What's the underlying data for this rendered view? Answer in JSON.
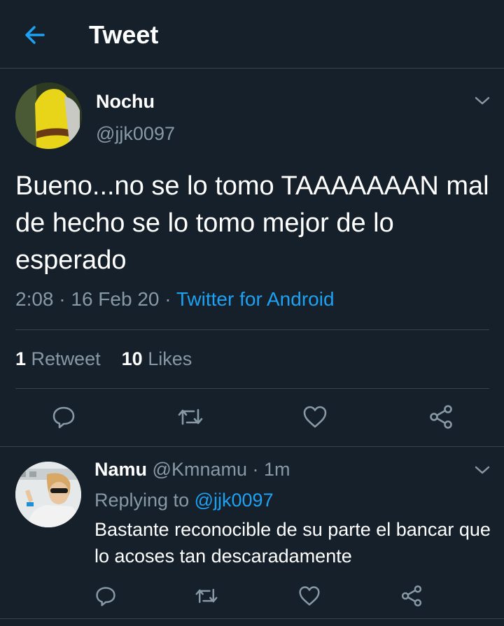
{
  "header": {
    "title": "Tweet",
    "back_icon": "arrow-left-icon"
  },
  "tweet": {
    "author_name": "Nochu",
    "author_handle": "@jjk0097",
    "text": "Bueno...no se lo tomo TAAAAAAAN mal de hecho se lo tomo mejor de lo esperado",
    "timestamp": "2:08 · 16 Feb 20 · ",
    "source": "Twitter for Android",
    "retweet_count": "1",
    "retweet_label": "Retweet",
    "like_count": "10",
    "like_label": "Likes"
  },
  "reply": {
    "author_name": "Namu",
    "author_handle": "@Kmnamu",
    "time": "· 1m",
    "replying_prefix": "Replying to",
    "replying_to": "@jjk0097",
    "text": "Bastante reconocible de su parte el bancar que lo acoses tan descaradamente"
  },
  "colors": {
    "background": "#15202b",
    "accent": "#1da1f2",
    "muted": "#8899a6",
    "divider": "#38444d"
  }
}
